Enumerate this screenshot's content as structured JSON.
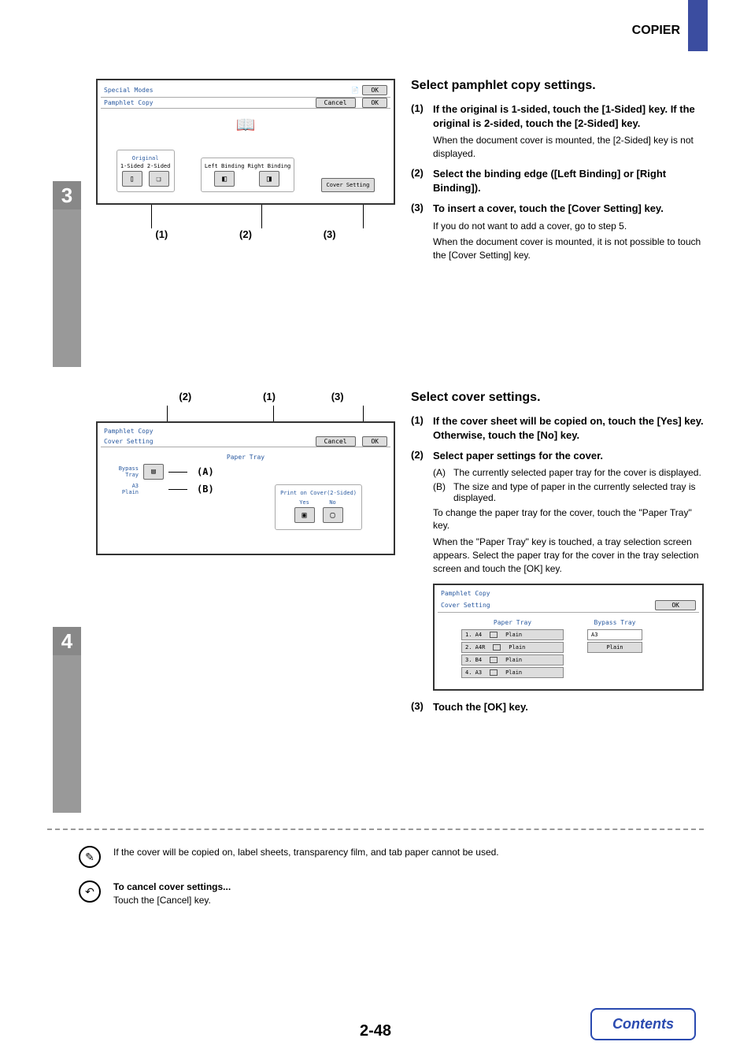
{
  "header": {
    "section": "COPIER"
  },
  "step3": {
    "num": "3",
    "screen": {
      "title": "Special Modes",
      "ok1": "OK",
      "subtitle": "Pamphlet Copy",
      "cancel": "Cancel",
      "ok2": "OK",
      "group_original": "Original",
      "opt_1sided": "1-Sided",
      "opt_2sided": "2-Sided",
      "left_binding": "Left Binding",
      "right_binding": "Right Binding",
      "cover_setting": "Cover Setting"
    },
    "callouts": {
      "c1": "(1)",
      "c2": "(2)",
      "c3": "(3)"
    },
    "heading": "Select pamphlet copy settings.",
    "i1_num": "(1)",
    "i1_bold": "If the original is 1-sided, touch the [1-Sided] key. If the original is 2-sided, touch the [2-Sided] key.",
    "i1_sub": "When the document cover is mounted, the [2-Sided] key is not displayed.",
    "i2_num": "(2)",
    "i2_bold": "Select the binding edge ([Left Binding] or [Right Binding]).",
    "i3_num": "(3)",
    "i3_bold": "To insert a cover, touch the [Cover Setting] key.",
    "i3_sub1": "If you do not want to add a cover, go to step 5.",
    "i3_sub2": "When the document cover is mounted, it is not possible to touch the [Cover Setting] key."
  },
  "step4": {
    "num": "4",
    "callouts_top": {
      "c2": "(2)",
      "c1": "(1)",
      "c3": "(3)"
    },
    "screen1": {
      "title": "Pamphlet Copy",
      "subtitle": "Cover Setting",
      "cancel": "Cancel",
      "ok": "OK",
      "paper_tray": "Paper Tray",
      "bypass": "Bypass Tray",
      "a3": "A3",
      "plain": "Plain",
      "print_on_cover": "Print on Cover(2-Sided)",
      "yes": "Yes",
      "no": "No",
      "labA": "(A)",
      "labB": "(B)"
    },
    "heading": "Select cover settings.",
    "i1_num": "(1)",
    "i1_bold": "If the cover sheet will be copied on, touch the [Yes] key. Otherwise, touch the [No] key.",
    "i2_num": "(2)",
    "i2_bold": "Select paper settings for the cover.",
    "i2_a_label": "(A)",
    "i2_a": "The currently selected paper tray for the cover is displayed.",
    "i2_b_label": "(B)",
    "i2_b": "The size and type of paper in the currently selected tray is displayed.",
    "i2_sub1": "To change the paper tray for the cover, touch the \"Paper Tray\" key.",
    "i2_sub2": "When the \"Paper Tray\" key is touched, a tray selection screen appears. Select the paper tray for the cover in the tray selection screen and touch the [OK] key.",
    "screen2": {
      "title": "Pamphlet Copy",
      "subtitle": "Cover Setting",
      "ok": "OK",
      "paper_tray_hdr": "Paper Tray",
      "bypass_hdr": "Bypass Tray",
      "t1": "1. A4",
      "t1p": "Plain",
      "t2": "2. A4R",
      "t2p": "Plain",
      "t3": "3. B4",
      "t3p": "Plain",
      "t4": "4. A3",
      "t4p": "Plain",
      "b1": "A3",
      "b1p": "Plain"
    },
    "i3_num": "(3)",
    "i3_bold": "Touch the [OK] key."
  },
  "note1": "If the cover will be copied on, label sheets, transparency film, and tab paper cannot be used.",
  "note2_title": "To cancel cover settings...",
  "note2_body": "Touch the [Cancel] key.",
  "footer": {
    "page": "2-48",
    "contents": "Contents"
  }
}
